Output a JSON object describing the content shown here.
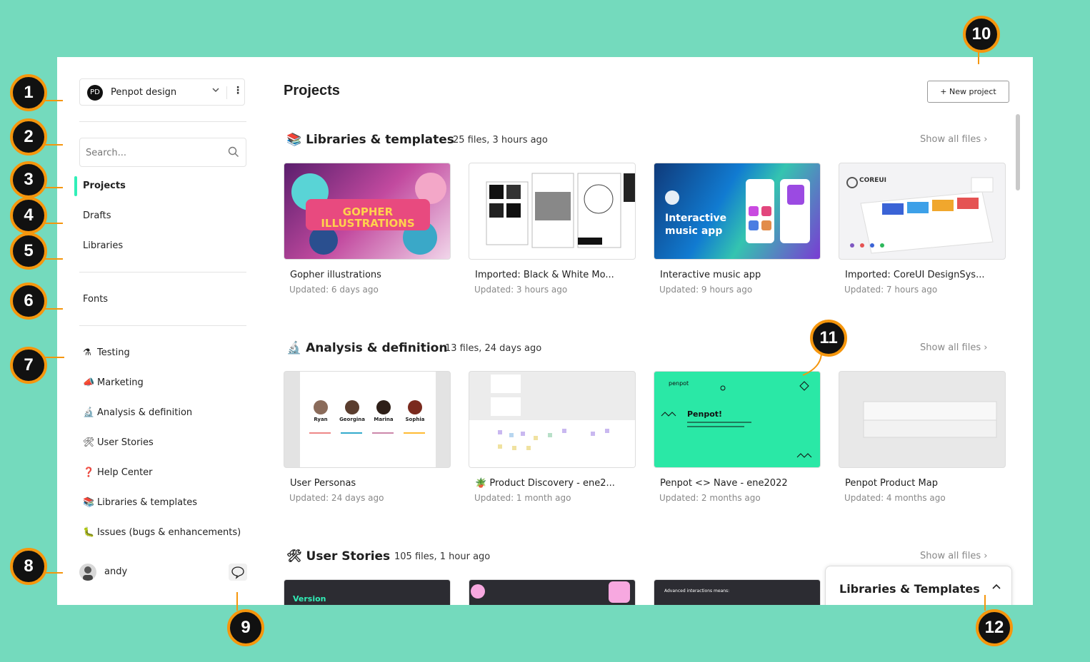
{
  "sidebar": {
    "team": {
      "avatar": "PD",
      "name": "Penpot design"
    },
    "search": {
      "placeholder": "Search..."
    },
    "nav": {
      "projects": "Projects",
      "drafts": "Drafts",
      "libraries": "Libraries",
      "fonts": "Fonts"
    },
    "projects": [
      {
        "emoji": "⚗",
        "label": "Testing"
      },
      {
        "emoji": "📣",
        "label": "Marketing"
      },
      {
        "emoji": "🔬",
        "label": "Analysis & definition"
      },
      {
        "emoji": "🛠",
        "label": "User Stories"
      },
      {
        "emoji": "❓",
        "label": "Help Center"
      },
      {
        "emoji": "📚",
        "label": "Libraries & templates"
      },
      {
        "emoji": "🐛",
        "label": "Issues (bugs & enhancements)"
      }
    ],
    "user": {
      "name": "andy"
    }
  },
  "main": {
    "title": "Projects",
    "new_project": "+ New project",
    "show_all": "Show all files",
    "sections": [
      {
        "emoji": "📚",
        "title": "Libraries & templates",
        "meta": "25 files, 3 hours ago",
        "files": [
          {
            "name": "Gopher illustrations",
            "updated": "Updated: 6 days ago",
            "thumb_text": "GOPHER ILLUSTRATIONS"
          },
          {
            "name": "Imported: Black & White Mo...",
            "updated": "Updated: 3 hours ago"
          },
          {
            "name": "Interactive music app",
            "updated": "Updated: 9 hours ago",
            "thumb_text": "Interactive music app"
          },
          {
            "name": "Imported: CoreUI DesignSys...",
            "updated": "Updated: 7 hours ago",
            "thumb_text": "COREUI"
          }
        ]
      },
      {
        "emoji": "🔬",
        "title": "Analysis & definition",
        "meta": "13 files, 24 days ago",
        "files": [
          {
            "name": "User Personas",
            "updated": "Updated: 24 days ago",
            "people": [
              "Ryan",
              "Georgina",
              "Marina",
              "Sophia"
            ]
          },
          {
            "name": "Product Discovery - ene2...",
            "updated": "Updated: 1 month ago",
            "emoji": "🪴"
          },
          {
            "name": "Penpot <> Nave - ene2022",
            "updated": "Updated: 2 months ago",
            "thumb_text": "Penpot!",
            "thumb_brand": "penpot"
          },
          {
            "name": "Penpot Product Map",
            "updated": "Updated: 4 months ago"
          }
        ]
      },
      {
        "emoji": "🛠",
        "title": "User Stories",
        "meta": "105 files, 1 hour ago",
        "files": [
          {
            "thumb_text": "Version"
          },
          {},
          {
            "thumb_text": "Advanced interactions means:"
          }
        ]
      }
    ]
  },
  "panel": {
    "title": "Libraries & Templates"
  },
  "badges": [
    "1",
    "2",
    "3",
    "4",
    "5",
    "6",
    "7",
    "8",
    "9",
    "10",
    "11",
    "12"
  ],
  "colors": {
    "page_bg": "#74dabd",
    "accent": "#31efb8",
    "badge_ring": "#f5960d",
    "badge_fill": "#111111"
  }
}
